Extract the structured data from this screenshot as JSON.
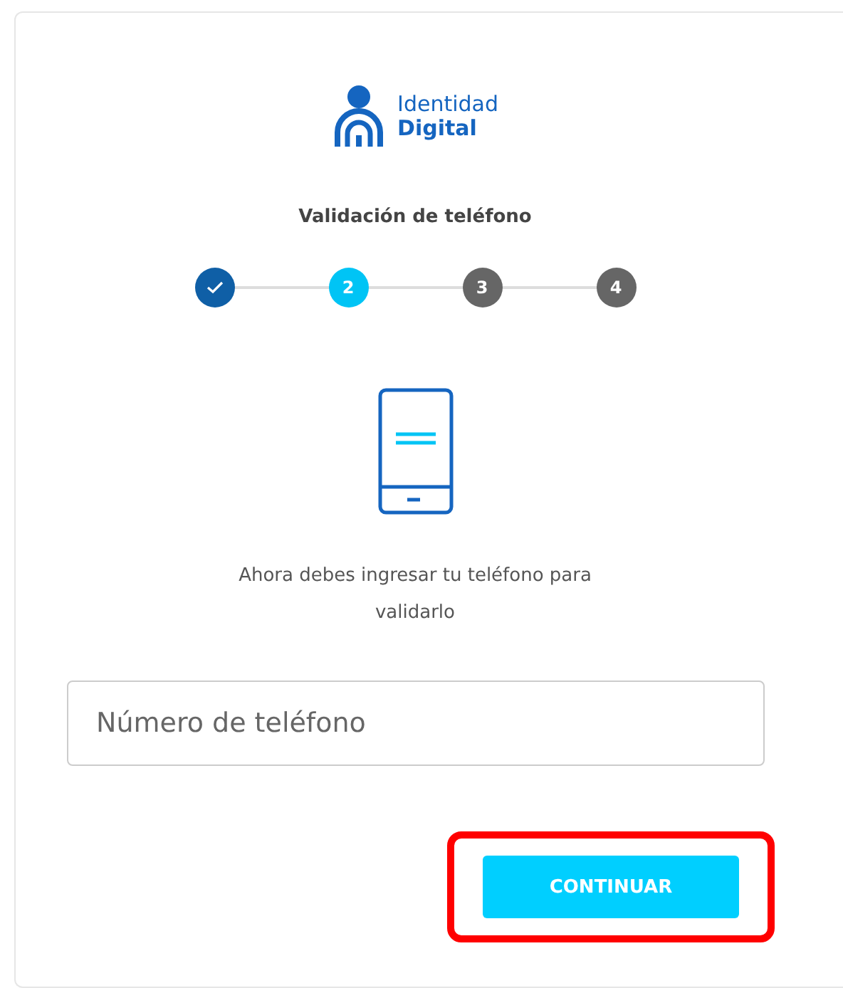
{
  "logo": {
    "line_1": "Identidad",
    "line_2": "Digital"
  },
  "title": "Validación de teléfono",
  "steps": [
    {
      "kind": "done"
    },
    {
      "label": "2",
      "kind": "current"
    },
    {
      "label": "3",
      "kind": "pending"
    },
    {
      "label": "4",
      "kind": "pending"
    }
  ],
  "message": "Ahora debes ingresar tu teléfono para validarlo",
  "phone_field": {
    "placeholder": "Número de teléfono"
  },
  "button": {
    "label": "CONTINUAR",
    "highlighted": true
  }
}
